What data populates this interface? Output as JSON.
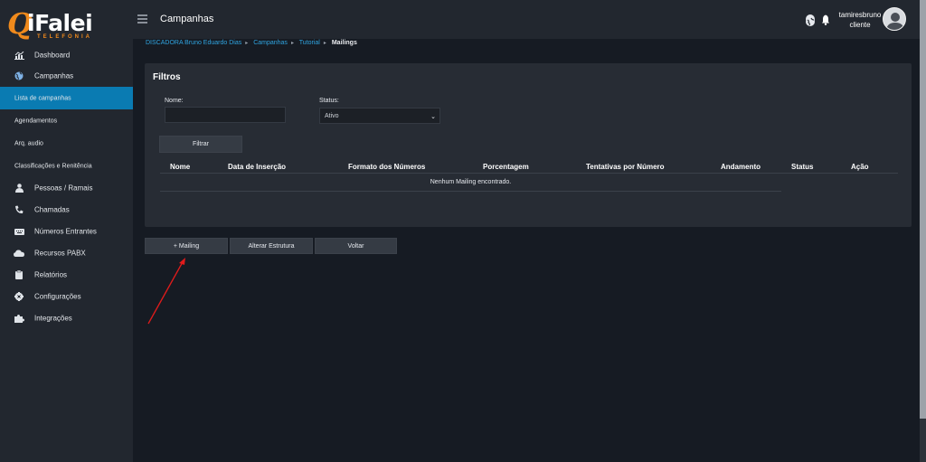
{
  "logo": {
    "mark": "Q",
    "name": "iFalei",
    "tagline": "TELEFONIA"
  },
  "sidebar": {
    "items": [
      {
        "label": "Dashboard",
        "icon": "chart-icon"
      },
      {
        "label": "Campanhas",
        "icon": "globe-icon"
      }
    ],
    "submenu": [
      {
        "label": "Lista de campanhas",
        "active": true
      },
      {
        "label": "Agendamentos"
      },
      {
        "label": "Arq. audio"
      },
      {
        "label": "Classificações e Renitência"
      }
    ],
    "items2": [
      {
        "label": "Pessoas / Ramais",
        "icon": "person-icon"
      },
      {
        "label": "Chamadas",
        "icon": "phone-icon"
      },
      {
        "label": "Números Entrantes",
        "icon": "keypad-icon"
      },
      {
        "label": "Recursos PABX",
        "icon": "cloud-icon"
      },
      {
        "label": "Relatórios",
        "icon": "clipboard-icon"
      },
      {
        "label": "Configurações",
        "icon": "gear-icon"
      },
      {
        "label": "Integrações",
        "icon": "puzzle-icon"
      }
    ]
  },
  "topbar": {
    "title": "Campanhas",
    "user": {
      "name": "tamiresbruno",
      "role": "cliente"
    }
  },
  "breadcrumb": {
    "items": [
      "DISCADORA Bruno Eduardo Dias",
      "Campanhas",
      "Tutorial"
    ],
    "current": "Mailings"
  },
  "filters": {
    "title": "Filtros",
    "name_label": "Nome:",
    "name_value": "",
    "status_label": "Status:",
    "status_value": "Ativo",
    "filter_button": "Filtrar"
  },
  "table": {
    "columns": [
      "Nome",
      "Data de Inserção",
      "Formato dos Números",
      "Porcentagem",
      "Tentativas por Número",
      "Andamento",
      "Status",
      "Ação"
    ],
    "empty_message": "Nenhum Mailing encontrado."
  },
  "actions": {
    "add_mailing": "+ Mailing",
    "alter_structure": "Alterar Estrutura",
    "back": "Voltar"
  },
  "colors": {
    "accent": "#0a7bb2",
    "brand_orange": "#f08a1c",
    "link_blue": "#2fa4e0",
    "annotation_arrow": "#e01b1b"
  }
}
